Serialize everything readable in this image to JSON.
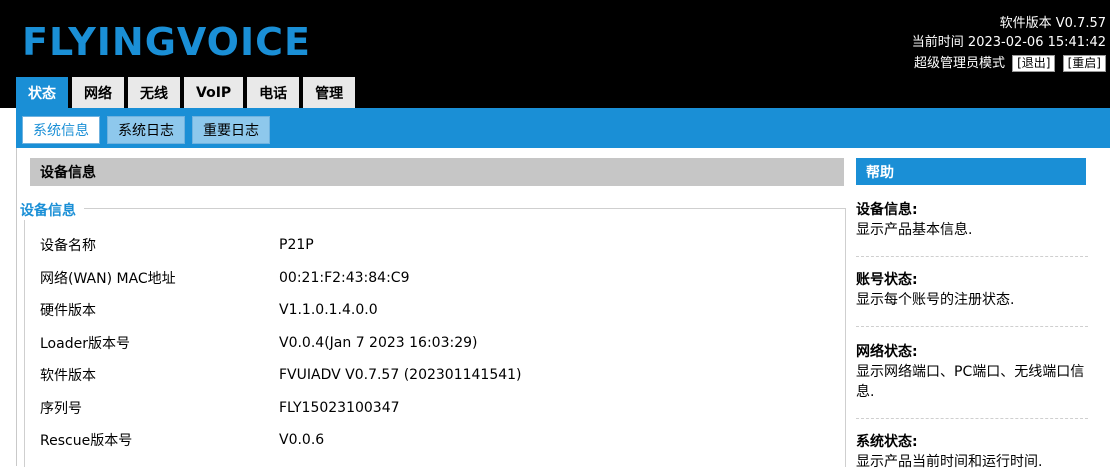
{
  "brand": {
    "logo": "FLYINGVOICE"
  },
  "status": {
    "software": "软件版本 V0.7.57",
    "time": "当前时间 2023-02-06 15:41:42",
    "mode": "超级管理员模式",
    "logout": "[退出]",
    "reboot": "[重启]"
  },
  "main_tabs": [
    "状态",
    "网络",
    "无线",
    "VoIP",
    "电话",
    "管理"
  ],
  "sub_tabs": [
    "系统信息",
    "系统日志",
    "重要日志"
  ],
  "section": {
    "title": "设备信息",
    "legend": "设备信息"
  },
  "device_info": [
    {
      "label": "设备名称",
      "value": "P21P"
    },
    {
      "label": "网络(WAN) MAC地址",
      "value": "00:21:F2:43:84:C9"
    },
    {
      "label": "硬件版本",
      "value": "V1.1.0.1.4.0.0"
    },
    {
      "label": "Loader版本号",
      "value": "V0.0.4(Jan 7 2023 16:03:29)"
    },
    {
      "label": "软件版本",
      "value": "FVUIADV V0.7.57 (202301141541)"
    },
    {
      "label": "序列号",
      "value": "FLY15023100347"
    },
    {
      "label": "Rescue版本号",
      "value": "V0.0.6"
    }
  ],
  "help": {
    "title": "帮助",
    "items": [
      {
        "title": "设备信息:",
        "desc": "显示产品基本信息."
      },
      {
        "title": "账号状态:",
        "desc": "显示每个账号的注册状态."
      },
      {
        "title": "网络状态:",
        "desc": "显示网络端口、PC端口、无线端口信息."
      },
      {
        "title": "系统状态:",
        "desc": "显示产品当前时间和运行时间."
      }
    ]
  },
  "colors": {
    "accent": "#1a8fd6",
    "header_bg": "#000000",
    "section_bg": "#c6c6c6"
  }
}
